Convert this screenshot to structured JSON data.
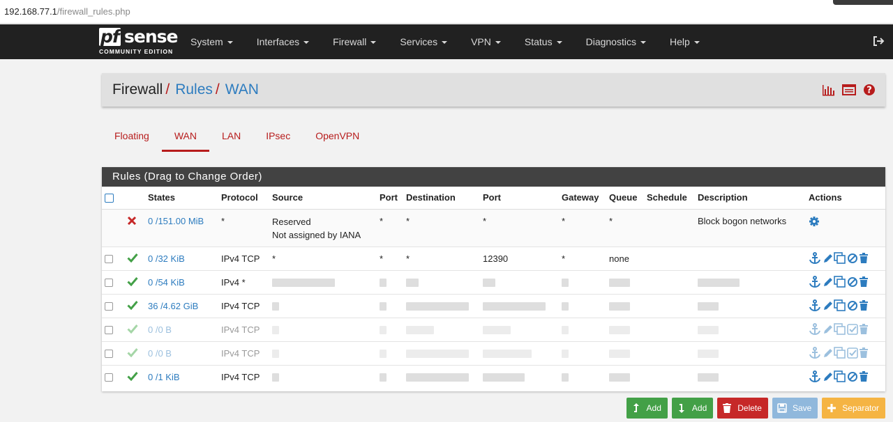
{
  "browser": {
    "url_host": "192.168.77.1",
    "url_path": "/firewall_rules.php"
  },
  "brand": {
    "logo_pf": "pf",
    "logo_sense": "sense",
    "edition": "COMMUNITY EDITION"
  },
  "nav": {
    "items": [
      {
        "label": "System"
      },
      {
        "label": "Interfaces"
      },
      {
        "label": "Firewall"
      },
      {
        "label": "Services"
      },
      {
        "label": "VPN"
      },
      {
        "label": "Status"
      },
      {
        "label": "Diagnostics"
      },
      {
        "label": "Help"
      }
    ],
    "logout_icon": "sign-out-icon"
  },
  "breadcrumb": {
    "root": "Firewall",
    "mid": "Rules",
    "current": "WAN",
    "sep": "/",
    "icons": [
      "chart-bar-icon",
      "table-list-icon",
      "question-circle-icon"
    ]
  },
  "tabs": [
    {
      "label": "Floating"
    },
    {
      "label": "WAN",
      "active": true
    },
    {
      "label": "LAN"
    },
    {
      "label": "IPsec"
    },
    {
      "label": "OpenVPN"
    }
  ],
  "panel": {
    "title": "Rules (Drag to Change Order)"
  },
  "table": {
    "headers": {
      "states": "States",
      "protocol": "Protocol",
      "source": "Source",
      "port": "Port",
      "destination": "Destination",
      "dport": "Port",
      "gateway": "Gateway",
      "queue": "Queue",
      "schedule": "Schedule",
      "description": "Description",
      "actions": "Actions"
    },
    "bogon": {
      "states": "0 /151.00 MiB",
      "protocol": "*",
      "source_line1": "Reserved",
      "source_line2": "Not assigned by IANA",
      "port": "*",
      "destination": "*",
      "dport": "*",
      "gateway": "*",
      "queue": "*",
      "description": "Block bogon networks"
    },
    "rows": [
      {
        "states": "0 /32 KiB",
        "protocol": "IPv4 TCP",
        "source": "*",
        "port": "*",
        "destination": "*",
        "dport": "12390",
        "gateway": "*",
        "queue": "none",
        "enabled": true
      },
      {
        "states": "0 /54 KiB",
        "protocol": "IPv4 *",
        "enabled": true
      },
      {
        "states": "36 /4.62 GiB",
        "protocol": "IPv4 TCP",
        "enabled": true
      },
      {
        "states": "0 /0 B",
        "protocol": "IPv4 TCP",
        "enabled": false
      },
      {
        "states": "0 /0 B",
        "protocol": "IPv4 TCP",
        "enabled": false
      },
      {
        "states": "0 /1 KiB",
        "protocol": "IPv4 TCP",
        "enabled": true
      }
    ]
  },
  "buttons": {
    "add_top": "Add",
    "add_bottom": "Add",
    "delete": "Delete",
    "save": "Save",
    "separator": "Separator"
  },
  "colors": {
    "accent_red": "#b71c1c",
    "link_blue": "#2d7cbf",
    "pass_green": "#43a047",
    "navbar": "#212121"
  }
}
